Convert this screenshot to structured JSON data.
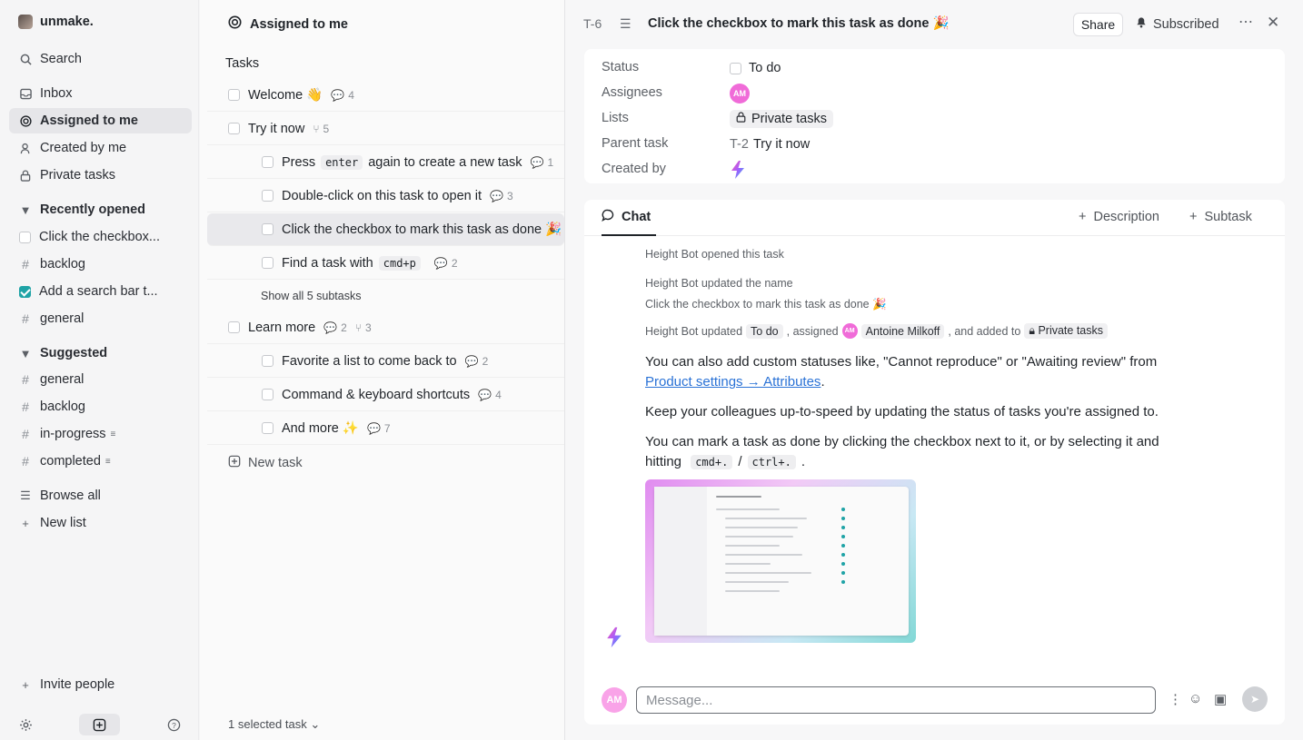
{
  "workspace": {
    "name": "unmake."
  },
  "sidebar": {
    "search": "Search",
    "nav": [
      {
        "label": "Inbox"
      },
      {
        "label": "Assigned to me"
      },
      {
        "label": "Created by me"
      },
      {
        "label": "Private tasks"
      }
    ],
    "recent_heading": "Recently opened",
    "recent": [
      {
        "label": "Click the checkbox..."
      },
      {
        "label": "backlog"
      },
      {
        "label": "Add a search bar t..."
      },
      {
        "label": "general"
      }
    ],
    "suggested_heading": "Suggested",
    "suggested": [
      {
        "label": "general"
      },
      {
        "label": "backlog"
      },
      {
        "label": "in-progress"
      },
      {
        "label": "completed"
      }
    ],
    "browse_all": "Browse all",
    "new_list": "New list",
    "invite": "Invite people"
  },
  "list": {
    "title": "Assigned to me",
    "section": "Tasks",
    "tasks": [
      {
        "label": "Welcome 👋",
        "comments": "4"
      },
      {
        "label": "Try it now",
        "subtasks": "5"
      },
      {
        "pre": "Press",
        "code": "enter",
        "post": "again to create a new task",
        "comments": "1"
      },
      {
        "label": "Double-click on this task to open it",
        "comments": "3"
      },
      {
        "label": "Click the checkbox to mark this task as done 🎉"
      },
      {
        "pre": "Find a task with",
        "code": "cmd+p",
        "post": "",
        "comments": "2"
      },
      {
        "label": "Learn more",
        "comments": "2",
        "subtasks": "3"
      },
      {
        "label": "Favorite a list to come back to",
        "comments": "2"
      },
      {
        "label": "Command & keyboard shortcuts",
        "comments": "4"
      },
      {
        "label": "And more ✨",
        "comments": "7"
      }
    ],
    "show_all": "Show all 5 subtasks",
    "new_task": "New task",
    "selected": "1 selected task"
  },
  "panel": {
    "task_id": "T-6",
    "title": "Click the checkbox to mark this task as done 🎉",
    "share": "Share",
    "subscribed": "Subscribed",
    "props": {
      "status_label": "Status",
      "status_value": "To do",
      "assignees_label": "Assignees",
      "assignee_initials": "AM",
      "lists_label": "Lists",
      "list_value": "Private tasks",
      "parent_label": "Parent task",
      "parent_id": "T-2",
      "parent_name": "Try it now",
      "created_label": "Created by"
    },
    "tabs": {
      "chat": "Chat",
      "description": "Description",
      "subtask": "Subtask"
    },
    "activity": {
      "opened": "Height Bot opened this task",
      "updated_name": "Height Bot updated the name",
      "new_name": "Click the checkbox to mark this task as done 🎉",
      "updated_prefix": "Height Bot updated",
      "status": "To do",
      "assigned": ", assigned",
      "assignee_initials": "AM",
      "assignee": "Antoine Milkoff",
      "added": ", and added to",
      "list": "Private tasks"
    },
    "messages": {
      "m1a": "You can also add custom statuses like, \"Cannot reproduce\" or \"Awaiting review\" from",
      "m1_link": "Product settings → Attributes",
      "m2": "Keep your colleagues up-to-speed by updating the status of tasks you're assigned to.",
      "m3a": "You can mark a task as done by clicking the checkbox next to it, or by selecting it and",
      "m3b": "hitting",
      "key1": "cmd+.",
      "key2": "ctrl+.",
      "slash": "/"
    },
    "composer": {
      "placeholder": "Message...",
      "initials": "AM"
    }
  }
}
